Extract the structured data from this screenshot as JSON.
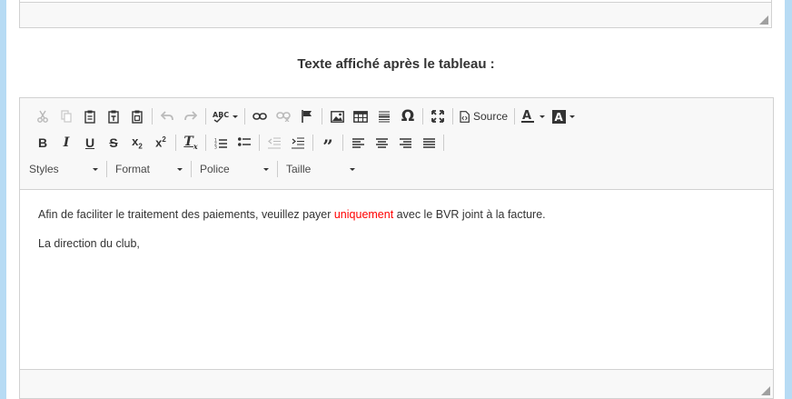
{
  "heading": "Texte affiché après le tableau :",
  "toolbar": {
    "source_label": "Source",
    "styles_label": "Styles",
    "format_label": "Format",
    "police_label": "Police",
    "taille_label": "Taille"
  },
  "content": {
    "p1_before": "Afin de faciliter le traitement des paiements, veuillez payer ",
    "p1_highlight": "uniquement",
    "p1_after": " avec le BVR joint à la facture.",
    "p2": "La direction du club,"
  },
  "colors": {
    "highlight": "#ff0000",
    "frame": "#b7dbf4"
  }
}
